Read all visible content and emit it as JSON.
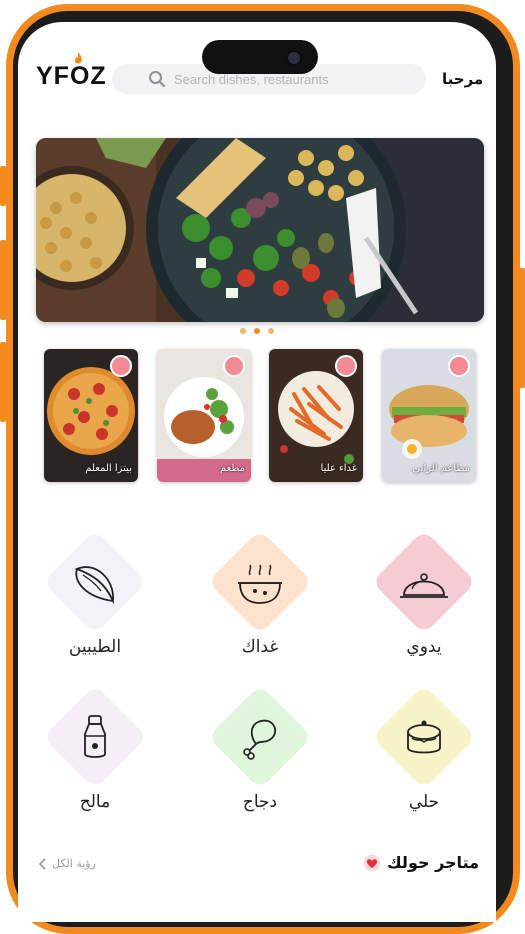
{
  "header": {
    "logo_text": "YFOZ",
    "search_placeholder": "Search dishes, restaurants",
    "greeting": "مرحبا"
  },
  "carousel": {
    "pages": 3,
    "active_page": 2
  },
  "restaurants": [
    {
      "caption": "مطاعم الرابي"
    },
    {
      "caption": "غداء عليا"
    },
    {
      "caption": "مطعم"
    },
    {
      "caption": "بيتزا المعلم"
    }
  ],
  "categories": [
    {
      "label": "يدوي",
      "icon": "cloche-icon",
      "color": "#F5CCD3"
    },
    {
      "label": "غداك",
      "icon": "soup-bowl-icon",
      "color": "#FDE3CD"
    },
    {
      "label": "الطيبين",
      "icon": "taco-icon",
      "color": "#F0F3F7"
    },
    {
      "label": "حلي",
      "icon": "cake-icon",
      "color": "#F8F3C8"
    },
    {
      "label": "دجاج",
      "icon": "chicken-leg-icon",
      "color": "#DFF5DC"
    },
    {
      "label": "مالح",
      "icon": "salt-shaker-icon",
      "color": "#F5EEF6"
    }
  ],
  "nearby": {
    "title": "متاجر حولك",
    "see_all": "رؤية الكل"
  },
  "colors": {
    "accent": "#F28A1E",
    "badge": "#F48A92",
    "heart": "#E0303A"
  }
}
